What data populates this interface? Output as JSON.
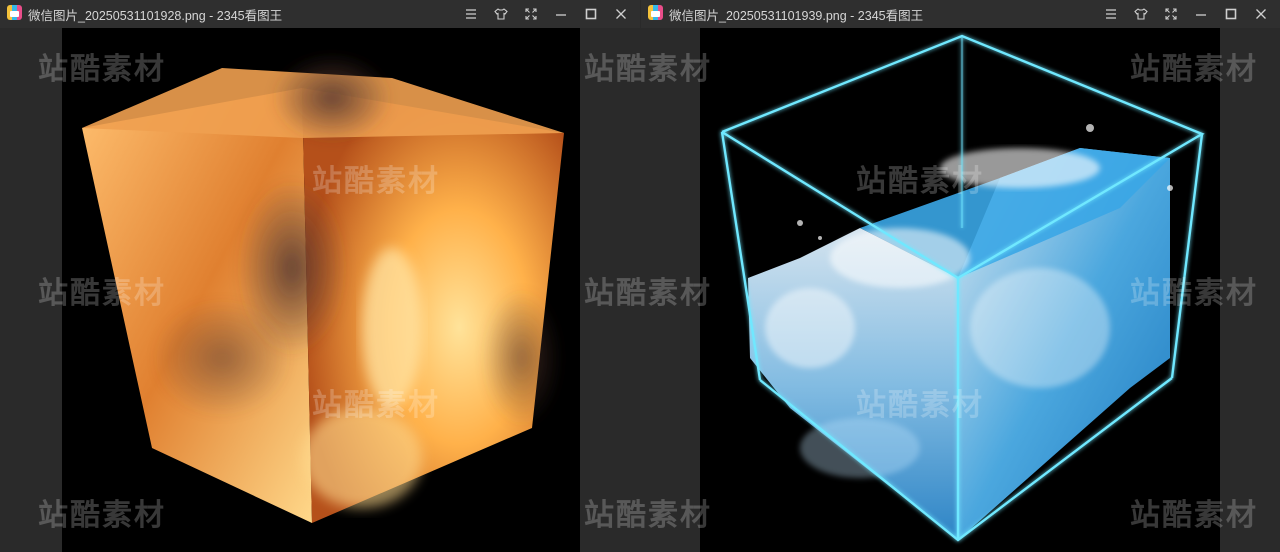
{
  "windows": [
    {
      "title": "微信图片_20250531101928.png - 2345看图王",
      "image_subject": "fire-cube",
      "controls": [
        "menu-icon",
        "skin-icon",
        "fullscreen-icon",
        "minimize-icon",
        "maximize-icon",
        "close-icon"
      ]
    },
    {
      "title": "微信图片_20250531101939.png - 2345看图王",
      "image_subject": "water-cube",
      "controls": [
        "menu-icon",
        "skin-icon",
        "fullscreen-icon",
        "minimize-icon",
        "maximize-icon",
        "close-icon"
      ]
    }
  ],
  "watermark": "站酷素材",
  "colors": {
    "titlebar": "#2f2f2f",
    "title_text": "#d6d6d6",
    "fire": "#ff9a2a",
    "water_edge": "#6fe8ff"
  }
}
